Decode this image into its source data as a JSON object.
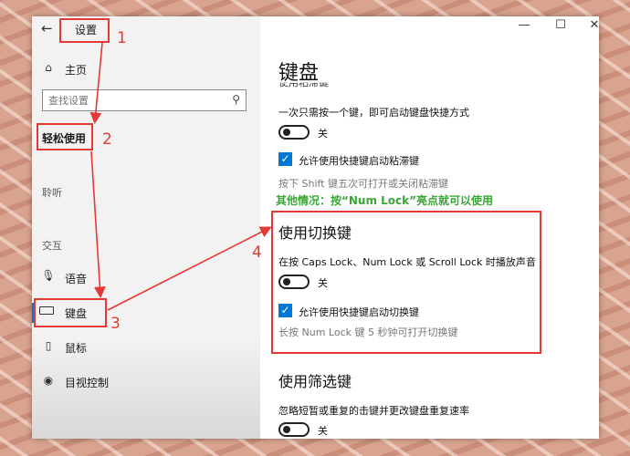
{
  "window": {
    "back_glyph": "←",
    "title": "设置",
    "controls": {
      "minimize": "—",
      "maximize": "☐",
      "close": "✕"
    }
  },
  "sidebar": {
    "home": {
      "icon": "home-icon",
      "label": "主页"
    },
    "search": {
      "placeholder": "查找设置",
      "icon": "search-icon"
    },
    "category": "轻松使用",
    "sections": {
      "hearing": "聆听",
      "interaction": "交互"
    },
    "items": [
      {
        "icon": "microphone-icon",
        "label": "语音"
      },
      {
        "icon": "keyboard-icon",
        "label": "键盘",
        "selected": true
      },
      {
        "icon": "mouse-icon",
        "label": "鼠标"
      },
      {
        "icon": "eye-icon",
        "label": "目视控制"
      }
    ]
  },
  "main": {
    "page_title": "键盘",
    "cutoff_text": "使用粘滞键",
    "sticky": {
      "description": "一次只需按一个键，即可启动键盘快捷方式",
      "toggle_state": "关",
      "checkbox_label": "允许使用快捷键启动粘滞键",
      "hint": "按下 Shift 键五次可打开或关闭粘滞键"
    },
    "annotation_note": "其他情况：按“Num Lock”亮点就可以使用",
    "toggle_keys": {
      "heading": "使用切换键",
      "description": "在按 Caps Lock、Num Lock 或 Scroll Lock 时播放声音",
      "toggle_state": "关",
      "checkbox_label": "允许使用快捷键启动切换键",
      "hint": "长按 Num Lock 键 5 秒钟可打开切换键"
    },
    "filter_keys": {
      "heading": "使用筛选键",
      "description": "忽略短暂或重复的击键并更改键盘重复速率",
      "toggle_state": "关"
    }
  },
  "annotations": {
    "step1": "1",
    "step2": "2",
    "step3": "3",
    "step4": "4"
  },
  "colors": {
    "accent": "#0078d7",
    "annotation_red": "#e53935",
    "annotation_green": "#3aa635"
  }
}
